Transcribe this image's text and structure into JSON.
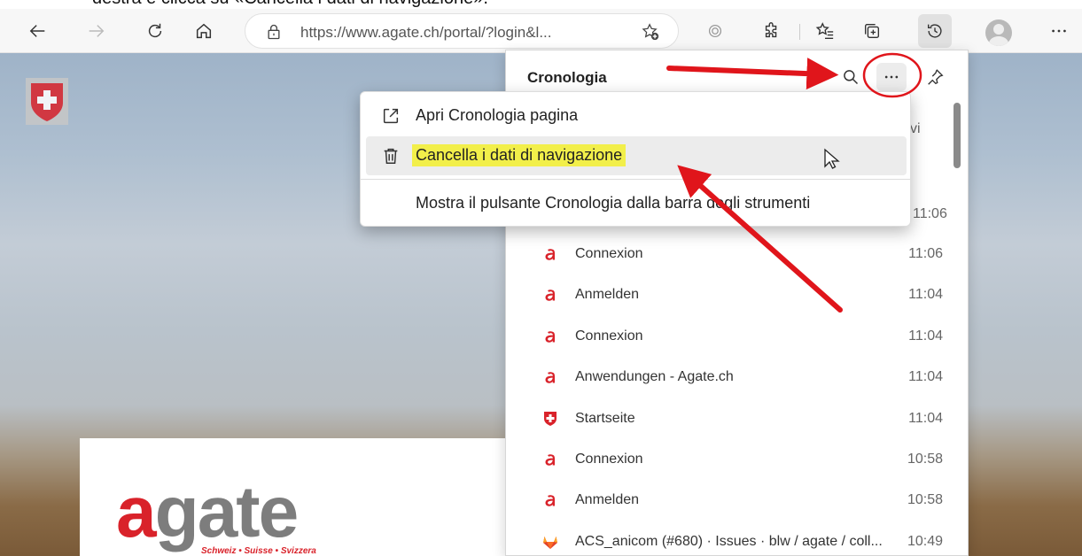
{
  "caption": {
    "text": "destra e clicca su «Cancella i dati di navigazione»."
  },
  "browser": {
    "address": {
      "url": "https://www.agate.ch/portal/?login&l..."
    }
  },
  "page": {
    "logo": {
      "word_first": "a",
      "word_rest": "gate",
      "tagline": "Schweiz • Suisse • Svizzera"
    }
  },
  "history_panel": {
    "title": "Cronologia",
    "peek_right_text": "vi",
    "peek_time": "11:06",
    "items": [
      {
        "title": "Connexion",
        "time": "11:06",
        "icon": "agate-icon"
      },
      {
        "title": "Anmelden",
        "time": "11:04",
        "icon": "agate-icon"
      },
      {
        "title": "Connexion",
        "time": "11:04",
        "icon": "agate-icon"
      },
      {
        "title": "Anwendungen - Agate.ch",
        "time": "11:04",
        "icon": "agate-icon"
      },
      {
        "title": "Startseite",
        "time": "11:04",
        "icon": "swiss-shield-icon"
      },
      {
        "title": "Connexion",
        "time": "10:58",
        "icon": "agate-icon"
      },
      {
        "title": "Anmelden",
        "time": "10:58",
        "icon": "agate-icon"
      },
      {
        "title": "ACS_anicom (#680) · Issues · blw / agate / coll...",
        "time": "10:49",
        "icon": "gitlab-icon"
      }
    ]
  },
  "context_menu": {
    "items": [
      {
        "label": "Apri Cronologia pagina",
        "icon": "open-external-icon"
      },
      {
        "label": "Cancella i dati di navigazione",
        "icon": "trash-icon",
        "highlighted": true
      },
      {
        "label": "Mostra il pulsante Cronologia dalla barra degli strumenti",
        "icon": ""
      }
    ]
  },
  "colors": {
    "annotation": "#e0151b",
    "highlight": "#f2ef4a",
    "agate_red": "#d9222a"
  }
}
